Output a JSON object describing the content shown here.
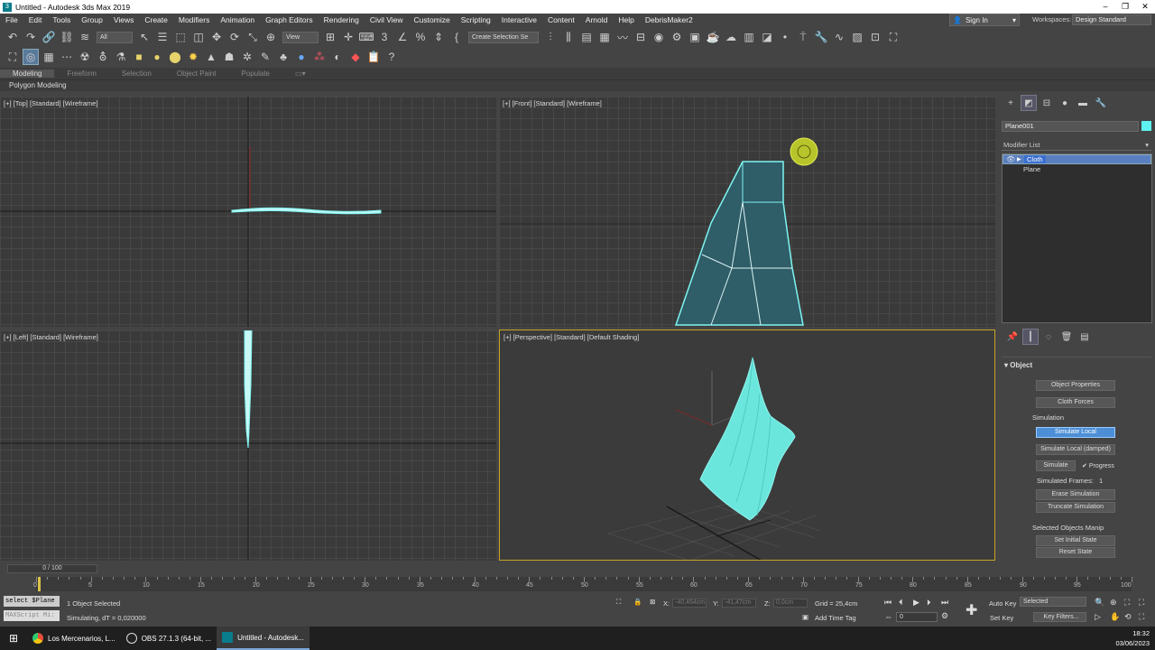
{
  "window": {
    "title": "Untitled - Autodesk 3ds Max 2019",
    "controls": [
      "–",
      "❐",
      "✕"
    ]
  },
  "menu": [
    "File",
    "Edit",
    "Tools",
    "Group",
    "Views",
    "Create",
    "Modifiers",
    "Animation",
    "Graph Editors",
    "Rendering",
    "Civil View",
    "Customize",
    "Scripting",
    "Interactive",
    "Content",
    "Arnold",
    "Help",
    "DebrisMaker2"
  ],
  "signin": "Sign In",
  "workspaces": {
    "label": "Workspaces:",
    "value": "Design Standard"
  },
  "toolbar": {
    "selection_filter": "All",
    "ref_coord": "View",
    "create_selection_set": "Create Selection Se"
  },
  "ribbon": {
    "tabs": [
      "Modeling",
      "Freeform",
      "Selection",
      "Object Paint",
      "Populate"
    ],
    "sub": "Polygon Modeling"
  },
  "viewports": {
    "top": "[+] [Top] [Standard] [Wireframe]",
    "front": "[+] [Front] [Standard] [Wireframe]",
    "left": "[+] [Left] [Standard] [Wireframe]",
    "persp": "[+] [Perspective] [Standard] [Default Shading]"
  },
  "cmdpanel": {
    "object_name": "Plane001",
    "object_color": "#5cf3f0",
    "modifier_list": "Modifier List",
    "stack": [
      {
        "name": "Cloth",
        "selected": true
      },
      {
        "name": "Plane",
        "selected": false
      }
    ],
    "rollout_title": "Object",
    "buttons": {
      "object_properties": "Object Properties",
      "cloth_forces": "Cloth Forces",
      "simulate_local": "Simulate Local",
      "simulate_local_damped": "Simulate Local (damped)",
      "simulate": "Simulate",
      "erase_simulation": "Erase Simulation",
      "truncate_simulation": "Truncate Simulation",
      "set_initial_state": "Set Initial State",
      "reset_state": "Reset State"
    },
    "labels": {
      "simulation": "Simulation",
      "progress": "Progress",
      "simulated_frames": "Simulated Frames:",
      "simulated_frames_value": "1",
      "selected_objects_manip": "Selected Objects Manip"
    }
  },
  "timeline": {
    "slider": "0 / 100",
    "ticks": [
      "0",
      "5",
      "10",
      "15",
      "20",
      "25",
      "30",
      "35",
      "40",
      "45",
      "50",
      "55",
      "60",
      "65",
      "70",
      "75",
      "80",
      "85",
      "90",
      "95",
      "100"
    ]
  },
  "status": {
    "maxscript_1": "select $Plane",
    "maxscript_2": "MAXScript Mi:",
    "selected": "1 Object Selected",
    "simulating": "Simulating, dT = 0,020000",
    "x_label": "X:",
    "x_value": "-40,464cm",
    "y_label": "Y:",
    "y_value": "-41,47cm",
    "z_label": "Z:",
    "z_value": "0,0cm",
    "grid": "Grid = 25,4cm",
    "add_time_tag": "Add Time Tag",
    "auto_key": "Auto Key",
    "set_key": "Set Key",
    "selected_dd": "Selected",
    "key_filters": "Key Filters...",
    "frame": "0"
  },
  "taskbar": {
    "items": [
      "Los Mercenarios, L...",
      "OBS 27.1.3 (64-bit, ...",
      "Untitled - Autodesk..."
    ],
    "time": "18:32",
    "date": "03/06/2023"
  }
}
